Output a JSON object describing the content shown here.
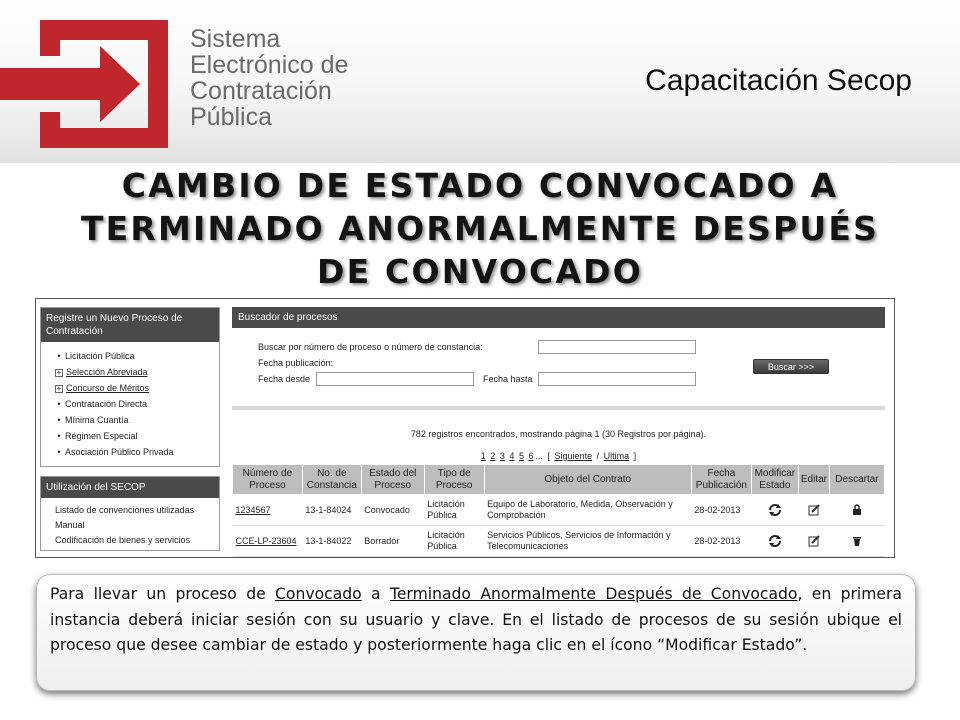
{
  "header": {
    "logo_lines": [
      "Sistema",
      "Electrónico de",
      "Contratación",
      "Pública"
    ],
    "right_title": "Capacitación Secop",
    "brand_color": "#c0272d"
  },
  "slide_title": {
    "lines": [
      "CAMBIO DE ESTADO CONVOCADO A",
      "TERMINADO ANORMALMENTE DESPUÉS",
      "DE CONVOCADO"
    ]
  },
  "screenshot": {
    "left_panel": {
      "box1_title": "Registre un Nuevo Proceso de Contratación",
      "items": [
        {
          "label": "Licitación Pública",
          "kind": "bullet"
        },
        {
          "label": "Selección Abreviada",
          "kind": "plus"
        },
        {
          "label": "Concurso de Méritos",
          "kind": "plus"
        },
        {
          "label": "Contratación Directa",
          "kind": "bullet"
        },
        {
          "label": "Mínima Cuantía",
          "kind": "bullet"
        },
        {
          "label": "Régimen Especial",
          "kind": "bullet"
        },
        {
          "label": "Asociación Público Privada",
          "kind": "bullet"
        }
      ],
      "box2_title": "Utilización del SECOP",
      "box2_items": [
        "Listado de convenciones utilizadas",
        "Manual",
        "Codificación de bienes y servicios"
      ]
    },
    "search": {
      "title": "Buscador de procesos",
      "label_search": "Buscar por número de proceso o número de constancia:",
      "label_fecha_pub": "Fecha publicación:",
      "label_desde": "Fecha desde",
      "label_hasta": "Fecha hasta",
      "button": "Buscar >>>"
    },
    "records_text": "782 registros encontrados, mostrando página 1 (30 Registros por página).",
    "pager": {
      "pages": [
        "1",
        "2",
        "3",
        "4",
        "5",
        "6"
      ],
      "ellipsis": "...",
      "open": "[",
      "next": "Siguiente",
      "slash": "/",
      "last": "Ultima",
      "close": "]"
    },
    "table": {
      "headers": [
        "Número de Proceso",
        "No. de Constancia",
        "Estado del Proceso",
        "Tipo de Proceso",
        "Objeto del Contrato",
        "Fecha Publicación",
        "Modificar Estado",
        "Editar",
        "Descartar"
      ],
      "rows": [
        {
          "numero": "1234567",
          "constancia": "13-1-84024",
          "estado": "Convocado",
          "tipo": "Licitación Pública",
          "objeto": "Equipo de Laboratorio, Medida, Observación y Comprobación",
          "fecha": "28-02-2013"
        },
        {
          "numero": "CCE-LP-23604",
          "constancia": "13-1-84022",
          "estado": "Borrador",
          "tipo": "Licitación Pública",
          "objeto": "Servicios Públicos, Servicios de Información y Telecomunicaciones",
          "fecha": "28-02-2013"
        }
      ]
    }
  },
  "caption": {
    "p1": "Para llevar un proceso de ",
    "u1": "Convocado",
    "p2": " a ",
    "u2": "Terminado Anormalmente Después de Convocado",
    "p3": ", en primera instancia deberá iniciar sesión con su usuario y clave. En el listado de procesos de su sesión ubique el proceso que desee cambiar de estado y posteriormente haga clic en el ícono “Modificar Estado”."
  }
}
